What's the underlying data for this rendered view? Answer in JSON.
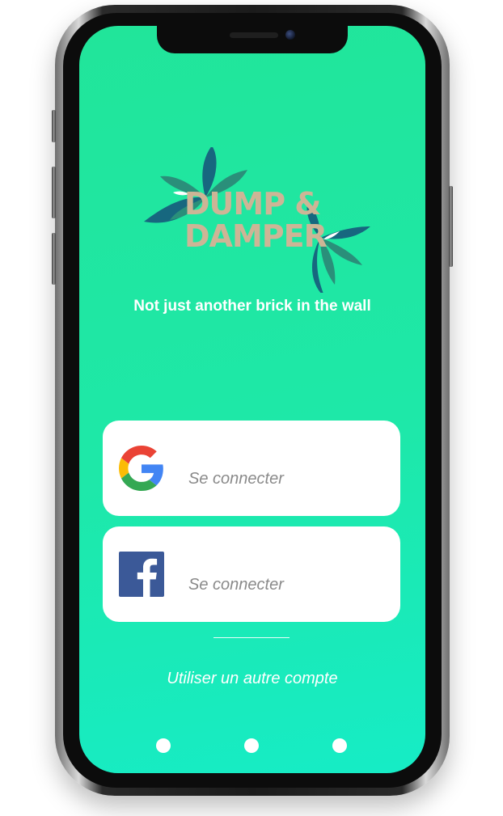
{
  "app": {
    "logo_line1": "DUMP &",
    "logo_line2": "DAMPER",
    "tagline": "Not just another brick in the wall"
  },
  "login": {
    "google_button": {
      "icon": "google-icon",
      "label": "Se connecter"
    },
    "facebook_button": {
      "icon": "facebook-icon",
      "label": "Se connecter"
    },
    "alternate_account_link": "Utiliser un autre compte"
  },
  "pager": {
    "dots": 3
  },
  "colors": {
    "background_top": "#21e59a",
    "background_bottom": "#16ecc6",
    "logo_text": "#cdb596",
    "leaf_dark": "#17677f",
    "leaf_mid": "#2a8f7a",
    "facebook_blue": "#3b5998",
    "button_bg": "#ffffff",
    "button_label": "#8a8a8a"
  }
}
